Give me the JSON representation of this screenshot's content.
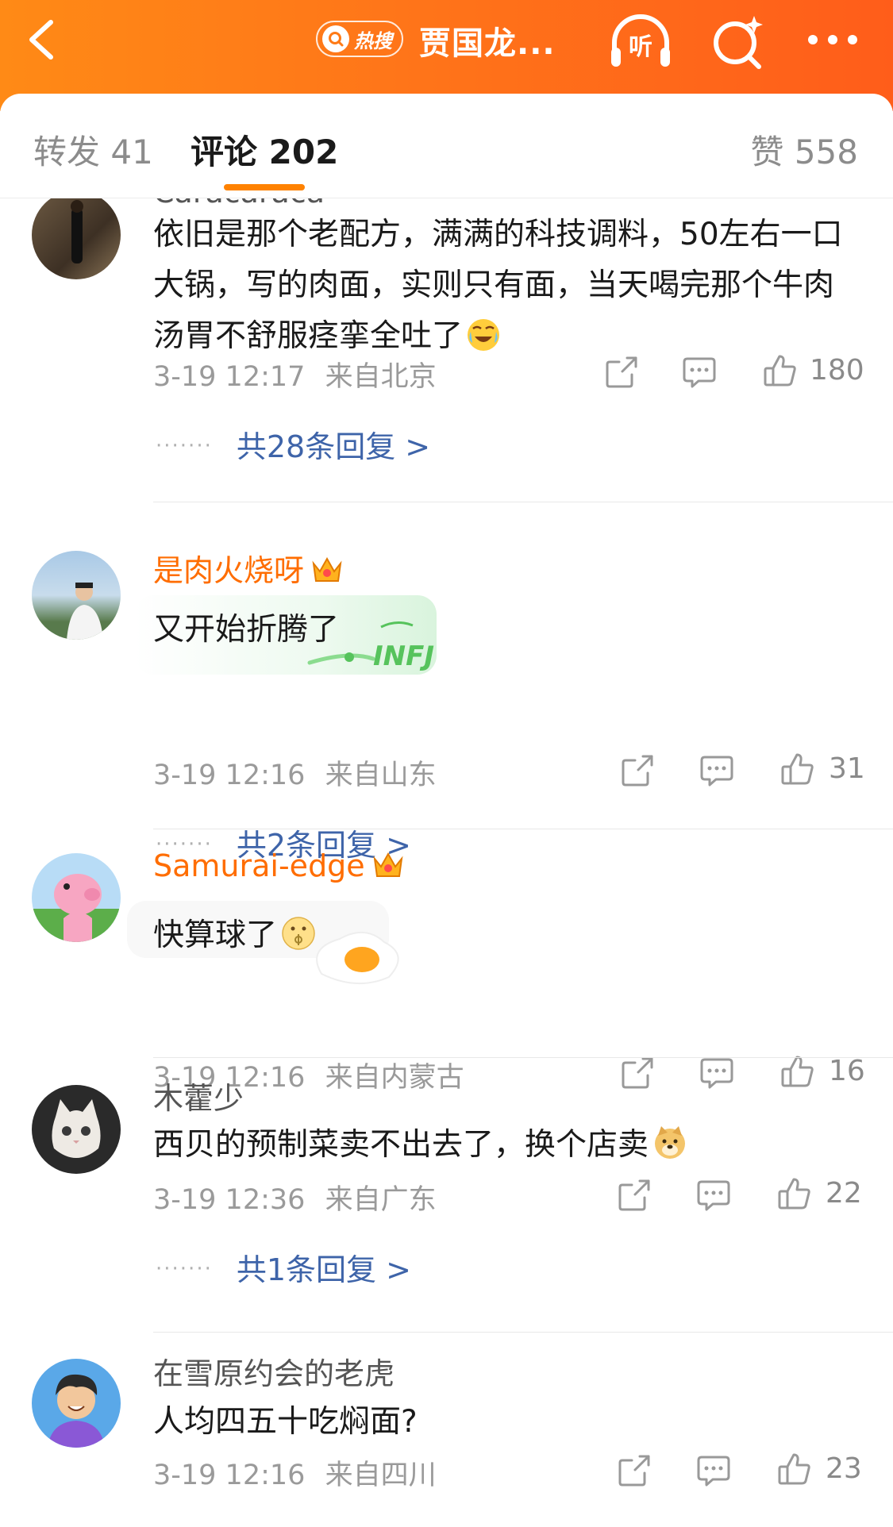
{
  "header": {
    "hot_badge": "热搜",
    "title": "贾国龙...",
    "listen_label": "听"
  },
  "tabs": [
    {
      "label": "转发 41"
    },
    {
      "label": "评论 202"
    },
    {
      "label": "赞 558"
    }
  ],
  "comments": [
    {
      "user": "Caracaraca",
      "text": "依旧是那个老配方，满满的科技调料，50左右一口大锅，写的肉面，实则只有面，当天喝完那个牛肉汤胃不舒服痉挛全吐了",
      "time": "3-19 12:17",
      "location": "来自北京",
      "likes": "180",
      "replies": "共28条回复 >"
    },
    {
      "user": "是肉火烧呀",
      "text": "又开始折腾了",
      "bubble_label": "INFJ",
      "time": "3-19 12:16",
      "location": "来自山东",
      "likes": "31",
      "replies": "共2条回复 >"
    },
    {
      "user": "Samurai-edge",
      "text": "快算球了",
      "time": "3-19 12:16",
      "location": "来自内蒙古",
      "likes": "16"
    },
    {
      "user": "木藿少",
      "text": "西贝的预制菜卖不出去了，换个店卖",
      "time": "3-19 12:36",
      "location": "来自广东",
      "likes": "22",
      "replies": "共1条回复 >"
    },
    {
      "user": "在雪原约会的老虎",
      "text": "人均四五十吃焖面?",
      "time": "3-19 12:16",
      "location": "来自四川",
      "likes": "23"
    }
  ],
  "colors": {
    "header_start": "#ff8a16",
    "header_end": "#ff5d1a",
    "tab_indicator": "#ff8200",
    "vip_name": "#ff6d00",
    "reply_link": "#3e64a9"
  },
  "icons": [
    "back-arrow-icon",
    "search-icon",
    "listen-headphones-icon",
    "search-sparkle-icon",
    "more-dots-icon",
    "share-icon",
    "comment-icon",
    "like-thumb-icon",
    "crown-icon"
  ]
}
